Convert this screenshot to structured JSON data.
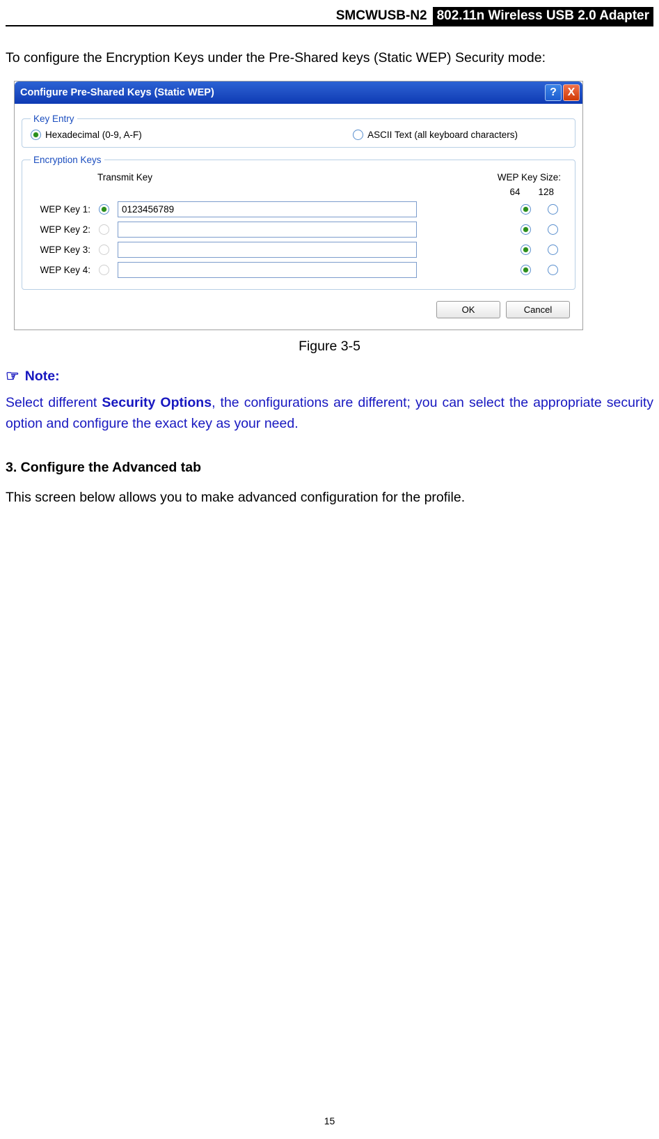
{
  "header": {
    "left": "SMCWUSB-N2",
    "right": "802.11n Wireless USB 2.0 Adapter"
  },
  "intro_text": "To configure the Encryption Keys under the Pre-Shared keys (Static WEP) Security mode:",
  "dialog": {
    "title": "Configure Pre-Shared Keys (Static WEP)",
    "help_label": "?",
    "close_label": "X",
    "key_entry": {
      "legend": "Key Entry",
      "hex_label": "Hexadecimal (0-9, A-F)",
      "ascii_label": "ASCII Text (all keyboard characters)"
    },
    "encryption": {
      "legend": "Encryption Keys",
      "transmit_key_header": "Transmit Key",
      "wep_size_header": "WEP Key Size:",
      "size_64": "64",
      "size_128": "128",
      "rows": [
        {
          "label": "WEP Key 1:",
          "value": "0123456789"
        },
        {
          "label": "WEP Key 2:",
          "value": ""
        },
        {
          "label": "WEP Key 3:",
          "value": ""
        },
        {
          "label": "WEP Key 4:",
          "value": ""
        }
      ]
    },
    "ok_label": "OK",
    "cancel_label": "Cancel"
  },
  "figure_caption": "Figure 3-5",
  "note": {
    "heading": "Note:",
    "body_pre": "Select different ",
    "body_strong": "Security Options",
    "body_post": ", the configurations are different; you can select the appropriate security option and configure the exact key as your need."
  },
  "section3": {
    "heading": "3.    Configure the Advanced tab",
    "body": "This screen below allows you to make advanced configuration for the profile."
  },
  "page_number": "15"
}
